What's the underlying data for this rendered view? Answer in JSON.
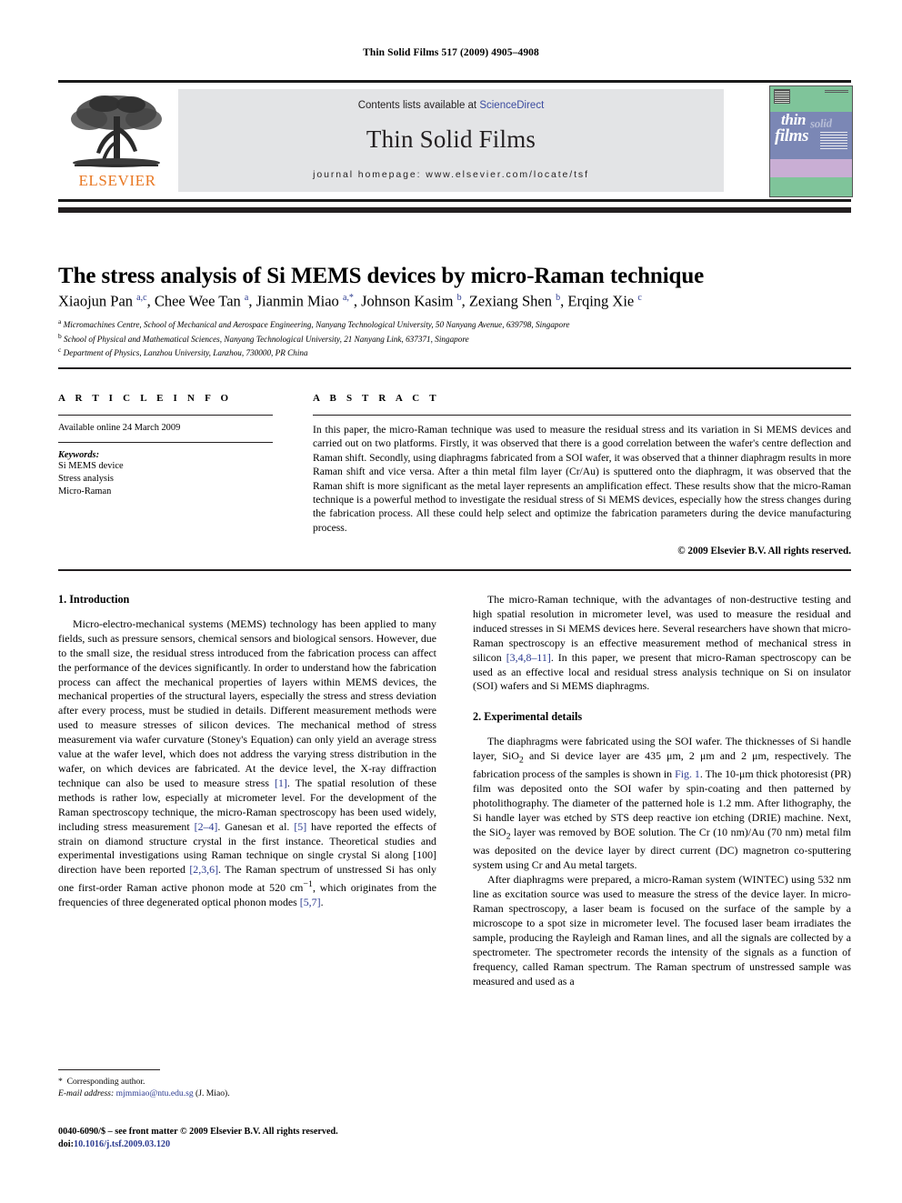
{
  "running_head": "Thin Solid Films 517 (2009) 4905–4908",
  "banner": {
    "publisher": "ELSEVIER",
    "contents_prefix": "Contents lists available at ",
    "contents_link": "ScienceDirect",
    "journal_title": "Thin Solid Films",
    "homepage": "journal homepage: www.elsevier.com/locate/tsf",
    "cover": {
      "word_thin": "thin",
      "word_solid": "solid",
      "word_films": "films"
    }
  },
  "article": {
    "title": "The stress analysis of Si MEMS devices by micro-Raman technique",
    "authors_html": "Xiaojun Pan <sup>a,c</sup>, Chee Wee Tan <sup>a</sup>, Jianmin Miao <sup>a,*</sup>, Johnson Kasim <sup>b</sup>, Zexiang Shen <sup>b</sup>, Erqing Xie <sup>c</sup>",
    "affiliations_html": "<sup>a</sup> Micromachines Centre, School of Mechanical and Aerospace Engineering, Nanyang Technological University, 50 Nanyang Avenue, 639798, Singapore<br><sup>b</sup> School of Physical and Mathematical Sciences, Nanyang Technological University, 21 Nanyang Link, 637371, Singapore<br><sup>c</sup> Department of Physics, Lanzhou University, Lanzhou, 730000, PR China"
  },
  "article_info": {
    "heading": "A R T I C L E   I N F O",
    "history": "Available online 24 March 2009",
    "keywords_label": "Keywords:",
    "keywords": [
      "Si MEMS device",
      "Stress analysis",
      "Micro-Raman"
    ]
  },
  "abstract": {
    "heading": "A B S T R A C T",
    "text": "In this paper, the micro-Raman technique was used to measure the residual stress and its variation in Si MEMS devices and carried out on two platforms. Firstly, it was observed that there is a good correlation between the wafer's centre deflection and Raman shift. Secondly, using diaphragms fabricated from a SOI wafer, it was observed that a thinner diaphragm results in more Raman shift and vice versa. After a thin metal film layer (Cr/Au) is sputtered onto the diaphragm, it was observed that the Raman shift is more significant as the metal layer represents an amplification effect. These results show that the micro-Raman technique is a powerful method to investigate the residual stress of Si MEMS devices, especially how the stress changes during the fabrication process. All these could help select and optimize the fabrication parameters during the device manufacturing process.",
    "copyright": "© 2009 Elsevier B.V. All rights reserved."
  },
  "sections": {
    "intro_heading": "1. Introduction",
    "intro_p1_html": "Micro-electro-mechanical systems (MEMS) technology has been applied to many fields, such as pressure sensors, chemical sensors and biological sensors. However, due to the small size, the residual stress introduced from the fabrication process can affect the performance of the devices significantly. In order to understand how the fabrication process can affect the mechanical properties of layers within MEMS devices, the mechanical properties of the structural layers, especially the stress and stress deviation after every process, must be studied in details. Different measurement methods were used to measure stresses of silicon devices. The mechanical method of stress measurement via wafer curvature (Stoney's Equation) can only yield an average stress value at the wafer level, which does not address the varying stress distribution in the wafer, on which devices are fabricated. At the device level, the X-ray diffraction technique can also be used to measure stress <a class=\"ref\" href=\"#\">[1]</a>. The spatial resolution of these methods is rather low, especially at micrometer level. For the development of the Raman spectroscopy technique, the micro-Raman spectroscopy has been used widely, including stress measurement <a class=\"ref\" href=\"#\">[2–4]</a>. Ganesan et al. <a class=\"ref\" href=\"#\">[5]</a> have reported the effects of strain on diamond structure crystal in the first instance. Theoretical studies and experimental investigations using Raman technique on single crystal Si along [100] direction have been reported <a class=\"ref\" href=\"#\">[2,3,6]</a>. The Raman spectrum of unstressed Si has only one first-order Raman active phonon mode at 520 cm<sup>−1</sup>, which originates from the frequencies of three degenerated optical phonon modes <a class=\"ref\" href=\"#\">[5,7]</a>.",
    "intro_p2_html": "The micro-Raman technique, with the advantages of non-destructive testing and high spatial resolution in micrometer level, was used to measure the residual and induced stresses in Si MEMS devices here. Several researchers have shown that micro-Raman spectroscopy is an effective measurement method of mechanical stress in silicon <a class=\"ref\" href=\"#\">[3,4,8–11]</a>. In this paper, we present that micro-Raman spectroscopy can be used as an effective local and residual stress analysis technique on Si on insulator (SOI) wafers and Si MEMS diaphragms.",
    "exp_heading": "2. Experimental details",
    "exp_p1_html": "The diaphragms were fabricated using the SOI wafer. The thicknesses of Si handle layer, SiO<sub>2</sub> and Si device layer are 435 μm, 2 μm and 2 μm, respectively. The fabrication process of the samples is shown in <a class=\"ref\" href=\"#\">Fig. 1</a>. The 10-μm thick photoresist (PR) film was deposited onto the SOI wafer by spin-coating and then patterned by photolithography. The diameter of the patterned hole is 1.2 mm. After lithography, the Si handle layer was etched by STS deep reactive ion etching (DRIE) machine. Next, the SiO<sub>2</sub> layer was removed by BOE solution. The Cr (10 nm)/Au (70 nm) metal film was deposited on the device layer by direct current (DC) magnetron co-sputtering system using Cr and Au metal targets.",
    "exp_p2_html": "After diaphragms were prepared, a micro-Raman system (WINTEC) using 532 nm line as excitation source was used to measure the stress of the device layer. In micro-Raman spectroscopy, a laser beam is focused on the surface of the sample by a microscope to a spot size in micrometer level. The focused laser beam irradiates the sample, producing the Rayleigh and Raman lines, and all the signals are collected by a spectrometer. The spectrometer records the intensity of the signals as a function of frequency, called Raman spectrum. The Raman spectrum of unstressed sample was measured and used as a"
  },
  "footnote": {
    "corresponding_html": "* &nbsp;Corresponding author.",
    "email_html": "<em>E-mail address:</em> <a href=\"#\">mjmmiao@ntu.edu.sg</a> (J. Miao)."
  },
  "imprint": {
    "line1": "0040-6090/$ – see front matter © 2009 Elsevier B.V. All rights reserved.",
    "doi_prefix": "doi:",
    "doi_value": "10.1016/j.tsf.2009.03.120"
  }
}
